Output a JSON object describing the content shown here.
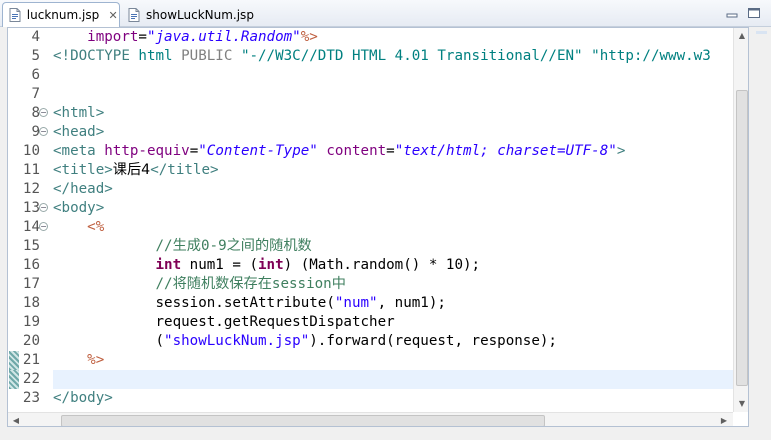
{
  "tabs": [
    {
      "label": "lucknum.jsp",
      "active": true,
      "close": "✕"
    },
    {
      "label": "showLuckNum.jsp",
      "active": false
    }
  ],
  "editor": {
    "current_line": 22,
    "lines": [
      {
        "num": "4",
        "html": "    <span class=\"attr\">import</span>=<span class=\"val\">\"java.util.Random\"</span><span class=\"jsp\">%&gt;</span>"
      },
      {
        "num": "5",
        "html": "<span class=\"tag\">&lt;!DOCTYPE</span> <span class=\"doctype-kw\">html</span> <span class=\"gray\">PUBLIC</span> <span class=\"doctype-kw\">\"-//W3C//DTD HTML 4.01 Transitional//EN\"</span> <span class=\"doctype-kw\">\"http://www.w3</span>"
      },
      {
        "num": "6",
        "html": ""
      },
      {
        "num": "7",
        "html": ""
      },
      {
        "num": "8",
        "fold": true,
        "html": "<span class=\"tag\">&lt;html&gt;</span>"
      },
      {
        "num": "9",
        "fold": true,
        "html": "<span class=\"tag\">&lt;head&gt;</span>"
      },
      {
        "num": "10",
        "html": "<span class=\"tag\">&lt;meta</span> <span class=\"attr\">http-equiv</span>=<span class=\"val\">\"Content-Type\"</span> <span class=\"attr\">content</span>=<span class=\"val\">\"text/html; charset=UTF-8\"</span><span class=\"tag\">&gt;</span>"
      },
      {
        "num": "11",
        "html": "<span class=\"tag\">&lt;title&gt;</span><span class=\"cjk\">课后4</span><span class=\"tag\">&lt;/title&gt;</span>"
      },
      {
        "num": "12",
        "html": "<span class=\"tag\">&lt;/head&gt;</span>"
      },
      {
        "num": "13",
        "fold": true,
        "html": "<span class=\"tag\">&lt;body&gt;</span>"
      },
      {
        "num": "14",
        "fold": true,
        "html": "    <span class=\"jsp\">&lt;%</span>"
      },
      {
        "num": "15",
        "html": "            <span class=\"cmt\">//<span class=\"cjk\">生成</span>0-9<span class=\"cjk\">之间的随机数</span></span>"
      },
      {
        "num": "16",
        "html": "            <span class=\"kw\">int</span> num1 = (<span class=\"kw\">int</span>) (Math.random() * 10);"
      },
      {
        "num": "17",
        "html": "            <span class=\"cmt\">//<span class=\"cjk\">将随机数保存在</span>session<span class=\"cjk\">中</span></span>"
      },
      {
        "num": "18",
        "html": "            session.setAttribute(<span class=\"str\">\"num\"</span>, num1);"
      },
      {
        "num": "19",
        "html": "            request.getRequestDispatcher"
      },
      {
        "num": "20",
        "html": "            (<span class=\"str\">\"showLuckNum.jsp\"</span>).forward(request, response);"
      },
      {
        "num": "21",
        "changed": true,
        "html": "    <span class=\"jsp\">%&gt;</span>"
      },
      {
        "num": "22",
        "changed": true,
        "html": ""
      },
      {
        "num": "23",
        "html": "<span class=\"tag\">&lt;/body&gt;</span>"
      }
    ]
  },
  "scroll": {
    "up": "▲",
    "down": "▼",
    "left": "◀",
    "right": "▶"
  }
}
